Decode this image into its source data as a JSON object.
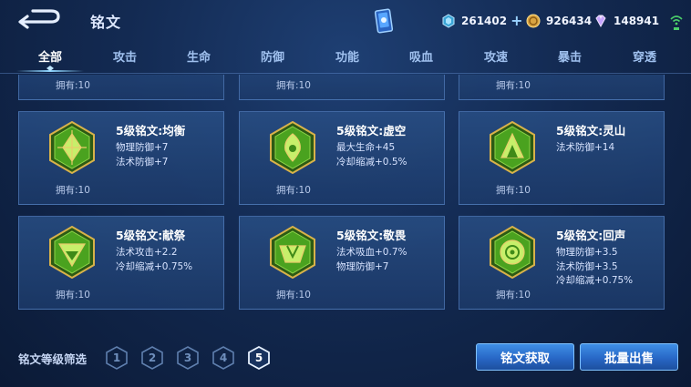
{
  "header": {
    "title": "铭文",
    "currencies": [
      {
        "icon": "diamond-icon",
        "value": "261402"
      },
      {
        "icon": "gold-coin-icon",
        "value": "926434"
      },
      {
        "icon": "gem-crystal-icon",
        "value": "148941"
      }
    ],
    "plus": "+"
  },
  "tabs": [
    "全部",
    "攻击",
    "生命",
    "防御",
    "功能",
    "吸血",
    "攻速",
    "暴击",
    "穿透"
  ],
  "active_tab": 0,
  "top_partial_owned": [
    "拥有:10",
    "拥有:10",
    "拥有:10"
  ],
  "cards": [
    {
      "name": "5级铭文:均衡",
      "attrs": [
        "物理防御+7",
        "法术防御+7"
      ],
      "owned": "拥有:10"
    },
    {
      "name": "5级铭文:虚空",
      "attrs": [
        "最大生命+45",
        "冷却缩减+0.5%"
      ],
      "owned": "拥有:10"
    },
    {
      "name": "5级铭文:灵山",
      "attrs": [
        "法术防御+14"
      ],
      "owned": "拥有:10"
    },
    {
      "name": "5级铭文:献祭",
      "attrs": [
        "法术攻击+2.2",
        "冷却缩减+0.75%"
      ],
      "owned": "拥有:10"
    },
    {
      "name": "5级铭文:敬畏",
      "attrs": [
        "法术吸血+0.7%",
        "物理防御+7"
      ],
      "owned": "拥有:10"
    },
    {
      "name": "5级铭文:回声",
      "attrs": [
        "物理防御+3.5",
        "法术防御+3.5",
        "冷却缩减+0.75%"
      ],
      "owned": "拥有:10"
    }
  ],
  "filter": {
    "label": "铭文等级筛选",
    "levels": [
      "1",
      "2",
      "3",
      "4",
      "5"
    ],
    "selected": "5"
  },
  "buttons": {
    "obtain": "铭文获取",
    "bulk_sell": "批量出售"
  },
  "colors": {
    "accent": "#7fc2ff",
    "rune_green": "#3f9a1e",
    "rune_gold": "#c9a23a"
  }
}
